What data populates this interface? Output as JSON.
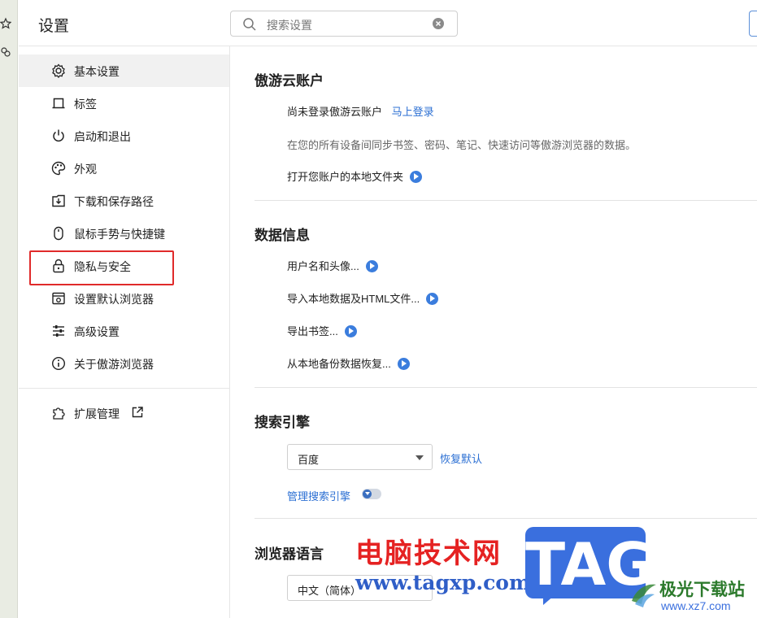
{
  "header": {
    "title": "设置",
    "search_placeholder": "搜索设置"
  },
  "sidebar": {
    "items": [
      {
        "label": "基本设置",
        "icon": "gear-icon",
        "active": true
      },
      {
        "label": "标签",
        "icon": "tab-icon"
      },
      {
        "label": "启动和退出",
        "icon": "power-icon"
      },
      {
        "label": "外观",
        "icon": "palette-icon"
      },
      {
        "label": "下载和保存路径",
        "icon": "download-icon"
      },
      {
        "label": "鼠标手势与快捷键",
        "icon": "mouse-icon"
      },
      {
        "label": "隐私与安全",
        "icon": "lock-icon",
        "highlighted": true
      },
      {
        "label": "设置默认浏览器",
        "icon": "browser-icon"
      },
      {
        "label": "高级设置",
        "icon": "sliders-icon"
      },
      {
        "label": "关于傲游浏览器",
        "icon": "info-icon"
      }
    ],
    "extensions": {
      "label": "扩展管理",
      "icon": "puzzle-icon",
      "link_icon": "external-link-icon"
    }
  },
  "account": {
    "title": "傲游云账户",
    "not_logged_in": "尚未登录傲游云账户",
    "login_link": "马上登录",
    "description": "在您的所有设备间同步书签、密码、笔记、快速访问等傲游浏览器的数据。",
    "open_folder": "打开您账户的本地文件夹"
  },
  "data_info": {
    "title": "数据信息",
    "items": [
      "用户名和头像...",
      "导入本地数据及HTML文件...",
      "导出书签...",
      "从本地备份数据恢复..."
    ]
  },
  "search_engine": {
    "title": "搜索引擎",
    "selected": "百度",
    "restore_default": "恢复默认",
    "manage": "管理搜索引擎"
  },
  "language": {
    "title": "浏览器语言",
    "selected": "中文（简体）"
  },
  "watermark": {
    "cn": "电脑技术网",
    "url": "www.tagxp.com",
    "tag": "TAG",
    "jg_name": "极光下载站",
    "jg_url": "www.xz7.com"
  },
  "colors": {
    "accent": "#2b6fd3",
    "highlight_border": "#e02a2a",
    "active_bg": "#f1f1f1"
  }
}
